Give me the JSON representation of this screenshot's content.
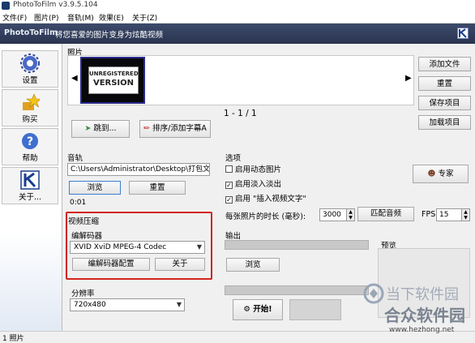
{
  "window": {
    "title": "PhotoToFilm v3.9.5.104"
  },
  "menu": [
    "文件(F)",
    "图片(P)",
    "音轨(M)",
    "效果(E)",
    "关于(Z)"
  ],
  "header": {
    "brand": "PhotoToFilm",
    "tagline": "将您喜爱的图片变身为炫酷视频"
  },
  "sidebar": [
    {
      "label": "设置",
      "icon": "gear-icon"
    },
    {
      "label": "购买",
      "icon": "star-icon"
    },
    {
      "label": "帮助",
      "icon": "help-icon"
    },
    {
      "label": "关于...",
      "icon": "k-logo-icon"
    }
  ],
  "photos": {
    "label": "照片",
    "thumbnail_line1": "UNREGISTERED",
    "thumbnail_line2": "VERSION",
    "counter": "1 - 1 / 1",
    "jump_button": "跳到...",
    "sort_button": "排序/添加字幕A"
  },
  "right_buttons": [
    "添加文件",
    "重置",
    "保存项目",
    "加载项目"
  ],
  "audio": {
    "label": "音轨",
    "path": "C:\\Users\\Administrator\\Desktop\\打包文件\\pe",
    "browse": "浏览",
    "reset": "重置",
    "time": "0:01"
  },
  "options": {
    "label": "选项",
    "checkboxes": [
      {
        "label": "启用动态图片",
        "checked": false
      },
      {
        "label": "启用淡入淡出",
        "checked": true
      },
      {
        "label": "启用 \"插入视频文字\"",
        "checked": true
      }
    ],
    "expert": "专家",
    "duration_label": "每张照片的时长 (毫秒):",
    "duration_value": "3000",
    "match_audio": "匹配音频",
    "fps_label": "FPS",
    "fps_value": "15"
  },
  "video": {
    "label": "视频压缩",
    "codec_label": "编解码器",
    "codec_value": "XVID XviD MPEG-4 Codec",
    "codec_config": "编解码器配置",
    "about": "关于"
  },
  "resolution": {
    "label": "分辨率",
    "value": "720x480"
  },
  "output": {
    "label": "输出",
    "browse": "浏览",
    "start": "开始!",
    "preview_label": "预览"
  },
  "statusbar": {
    "text": "1 照片"
  },
  "watermark": {
    "line1": "当下软件园",
    "line2": "合众软件园",
    "url": "www.hezhong.net"
  }
}
